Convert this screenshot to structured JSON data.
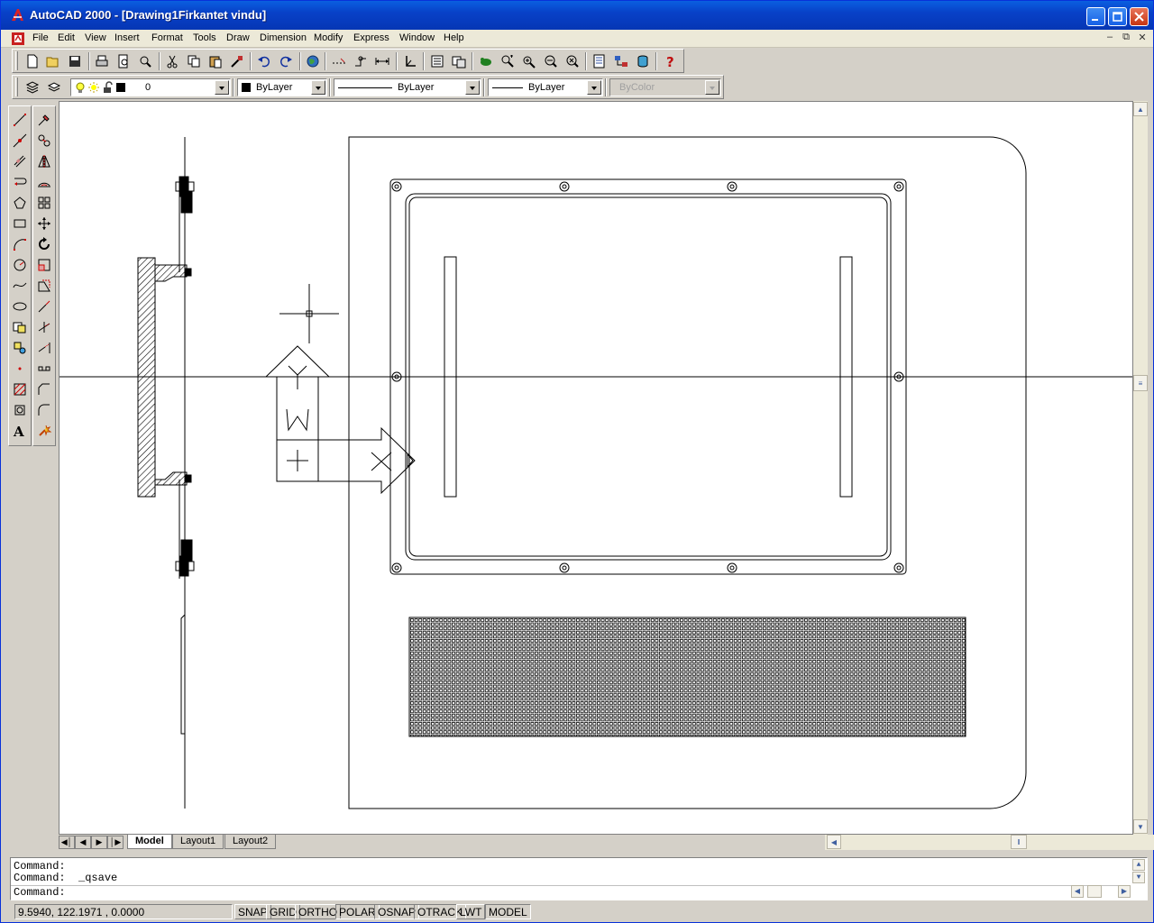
{
  "window": {
    "title": "AutoCAD 2000 - [Drawing1Firkantet vindu]"
  },
  "menubar": {
    "items": [
      "File",
      "Edit",
      "View",
      "Insert",
      "Format",
      "Tools",
      "Draw",
      "Dimension",
      "Modify",
      "Express",
      "Window",
      "Help"
    ]
  },
  "standard_toolbar": {
    "icons": [
      "new-icon",
      "open-icon",
      "save-icon",
      "print-icon",
      "print-preview-icon",
      "spelling-icon",
      "cut-icon",
      "copy-icon",
      "paste-icon",
      "match-properties-icon",
      "undo-icon",
      "redo-icon",
      "internet-icon",
      "snap-icon",
      "tracking-icon",
      "dimension-icon",
      "ucs-icon",
      "properties-icon",
      "design-center-icon",
      "pan-icon",
      "zoom-realtime-icon",
      "zoom-window-icon",
      "zoom-previous-icon",
      "properties-palette-icon",
      "design-center-palette-icon",
      "dbconnect-icon",
      "help-icon"
    ]
  },
  "properties_toolbar": {
    "layer_value": "0",
    "color_value": "ByLayer",
    "linetype_value": "ByLayer",
    "lineweight_value": "ByLayer",
    "plotstyle_value": "ByColor"
  },
  "draw_toolbar": {
    "icons": [
      "line-icon",
      "construction-line-icon",
      "multiline-icon",
      "polyline-icon",
      "polygon-icon",
      "rectangle-icon",
      "arc-icon",
      "circle-icon",
      "spline-icon",
      "ellipse-icon",
      "insert-block-icon",
      "make-block-icon",
      "point-icon",
      "hatch-icon",
      "region-icon",
      "multiline-text-icon"
    ]
  },
  "modify_toolbar": {
    "icons": [
      "erase-icon",
      "copy-object-icon",
      "mirror-icon",
      "offset-icon",
      "array-icon",
      "move-icon",
      "rotate-icon",
      "scale-icon",
      "stretch-icon",
      "lengthen-icon",
      "trim-icon",
      "extend-icon",
      "break-icon",
      "chamfer-icon",
      "fillet-icon",
      "explode-icon"
    ]
  },
  "layout_tabs": {
    "tabs": [
      "Model",
      "Layout1",
      "Layout2"
    ],
    "active": "Model"
  },
  "command_window": {
    "lines": [
      "Command:",
      "Command:  _qsave",
      "Command:"
    ]
  },
  "status_bar": {
    "coordinates": "9.5940,  122.1971 , 0.0000",
    "toggles": [
      "SNAP",
      "GRID",
      "ORTHO",
      "POLAR",
      "OSNAP",
      "OTRACK",
      "LWT",
      "MODEL"
    ]
  }
}
